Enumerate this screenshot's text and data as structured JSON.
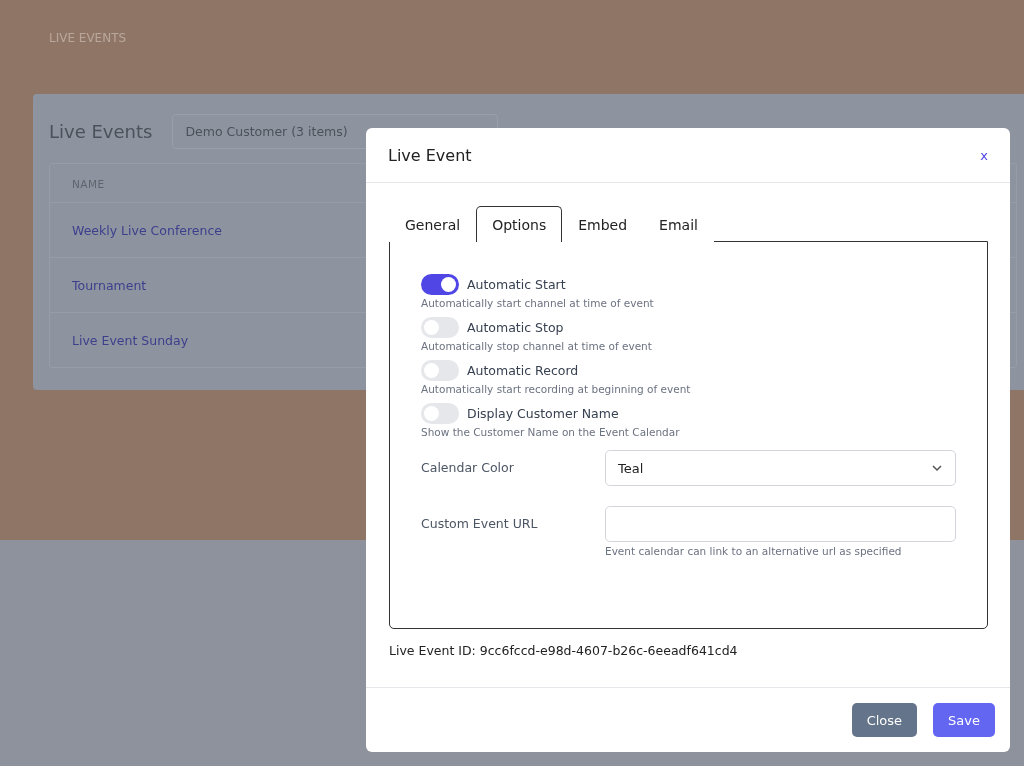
{
  "page": {
    "heading": "LIVE EVENTS"
  },
  "card": {
    "title": "Live Events",
    "customer_select": "Demo Customer (3 items)",
    "columns": [
      "NAME"
    ],
    "rows": [
      {
        "name": "Weekly Live Conference"
      },
      {
        "name": "Tournament"
      },
      {
        "name": "Live Event Sunday"
      }
    ]
  },
  "modal": {
    "title": "Live Event",
    "close_icon": "x",
    "tabs": [
      {
        "label": "General",
        "selected": false
      },
      {
        "label": "Options",
        "selected": true
      },
      {
        "label": "Embed",
        "selected": false
      },
      {
        "label": "Email",
        "selected": false
      }
    ],
    "toggles": [
      {
        "label": "Automatic Start",
        "help": "Automatically start channel at time of event",
        "on": true
      },
      {
        "label": "Automatic Stop",
        "help": "Automatically stop channel at time of event",
        "on": false
      },
      {
        "label": "Automatic Record",
        "help": "Automatically start recording at beginning of event",
        "on": false
      },
      {
        "label": "Display Customer Name",
        "help": "Show the Customer Name on the Event Calendar",
        "on": false
      }
    ],
    "calendar_color": {
      "label": "Calendar Color",
      "value": "Teal"
    },
    "custom_url": {
      "label": "Custom Event URL",
      "help": "Event calendar can link to an alternative url as specified"
    },
    "event_id": "Live Event ID: 9cc6fccd-e98d-4607-b26c-6eeadf641cd4",
    "buttons": [
      {
        "label": "Close",
        "kind": "secondary"
      },
      {
        "label": "Save",
        "kind": "primary"
      }
    ]
  }
}
